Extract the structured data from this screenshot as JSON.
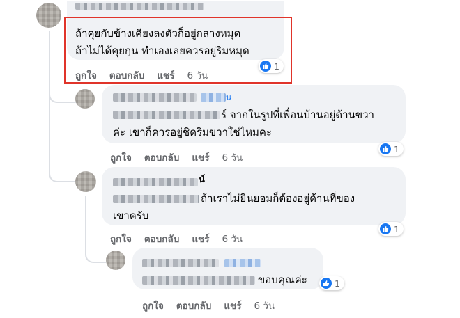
{
  "comments": [
    {
      "text_lines": [
        "ถ้าคุยกับข้างเคียงลงตัวก็อยู่กลางหมุด",
        "ถ้าไม่ได้คุยกุน ทำเองเลยควรอยู่ริมหมุด"
      ],
      "actions": {
        "like": "ถูกใจ",
        "reply": "ตอบกลับ",
        "share": "แชร์",
        "time": "6 วัน"
      },
      "reaction_count": "1"
    },
    {
      "text_lines": [
        "ร์ จากในรูปที่เพื่อนบ้านอยู่ด้านขวา",
        "ค่ะ เขาก็ควรอยู่ชิดริมขวาใช่ไหมคะ"
      ],
      "name_suffix": "น",
      "actions": {
        "like": "ถูกใจ",
        "reply": "ตอบกลับ",
        "share": "แชร์",
        "time": "6 วัน"
      },
      "reaction_count": "1"
    },
    {
      "text_lines": [
        "ถ้าเราไม่ยินยอมก็ต้องอยู่ด้านที่ของ",
        "เขาครับ"
      ],
      "name_suffix": "น์",
      "actions": {
        "like": "ถูกใจ",
        "reply": "ตอบกลับ",
        "share": "แชร์",
        "time": "6 วัน"
      },
      "reaction_count": "1"
    },
    {
      "text_lines": [
        "ขอบคุณค่ะ"
      ],
      "actions": {
        "like": "ถูกใจ",
        "reply": "ตอบกลับ",
        "share": "แชร์",
        "time": "6 วัน"
      },
      "reaction_count": "1"
    }
  ],
  "icons": {
    "reaction": "like-thumb-icon"
  },
  "colors": {
    "bubble": "#f0f2f5",
    "highlight": "#e0342a",
    "like": "#1877f2",
    "meta": "#65676b"
  }
}
